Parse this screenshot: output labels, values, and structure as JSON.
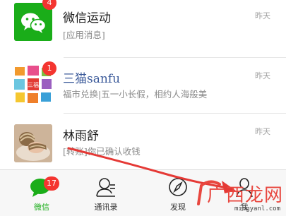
{
  "chats": [
    {
      "name": "微信运动",
      "preview": "[应用消息]",
      "time": "昨天",
      "badge": "4",
      "avatar": "wechat-logo"
    },
    {
      "name": "三猫sanfu",
      "preview": "福市兑换|五一小长假，相约人海般美",
      "time": "昨天",
      "badge": "1",
      "avatar": "brand-grid-logo"
    },
    {
      "name": "林雨舒",
      "preview": "[转账]你已确认收钱",
      "time": "昨天",
      "badge": "",
      "avatar": "baby-photo"
    }
  ],
  "tabbar": {
    "items": [
      {
        "label": "微信",
        "badge": "17",
        "icon": "chat-bubble-icon",
        "active": true
      },
      {
        "label": "通讯录",
        "icon": "contacts-icon",
        "active": false
      },
      {
        "label": "发现",
        "icon": "compass-icon",
        "active": false
      },
      {
        "label": "我",
        "icon": "person-icon",
        "active": false
      }
    ]
  },
  "watermark": {
    "text": "广西龙网",
    "url": "mingyanl.com"
  },
  "colors": {
    "accent": "#1aad19",
    "badge": "#f43530",
    "annotation_arrow": "#e53935"
  }
}
